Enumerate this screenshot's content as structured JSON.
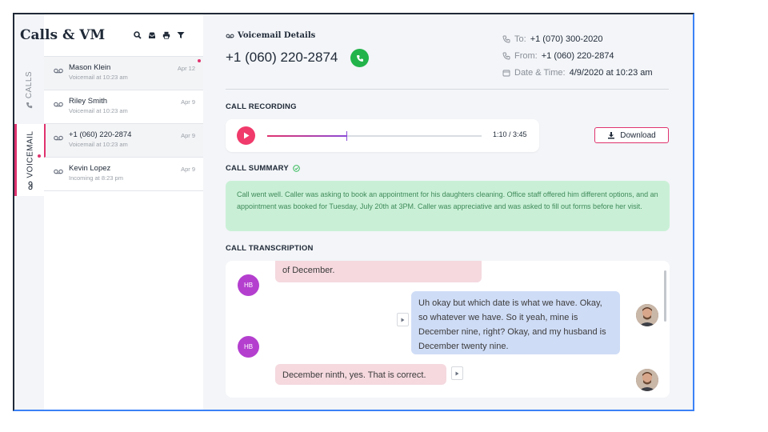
{
  "app": {
    "title": "Calls & VM"
  },
  "tabs": {
    "calls": "CALLS",
    "voicemail": "VOICEMAIL"
  },
  "list": [
    {
      "name": "Mason Klein",
      "sub": "Voicemail at 10:23 am",
      "date": "Apr 12",
      "unread": true
    },
    {
      "name": "Riley Smith",
      "sub": "Voicemail at 10:23 am",
      "date": "Apr 9",
      "unread": false
    },
    {
      "name": "+1 (060) 220-2874",
      "sub": "Voicemail at 10:23 am",
      "date": "Apr 9",
      "unread": false
    },
    {
      "name": "Kevin Lopez",
      "sub": "Incoming at 8:23 pm",
      "date": "Apr 9",
      "unread": false
    }
  ],
  "detail": {
    "section_title": "Voicemail Details",
    "phone": "+1 (060) 220-2874",
    "to_label": "To:",
    "to_value": "+1 (070) 300-2020",
    "from_label": "From:",
    "from_value": "+1 (060) 220-2874",
    "datetime_label": "Date & Time:",
    "datetime_value": "4/9/2020 at 10:23 am"
  },
  "recording": {
    "heading": "CALL RECORDING",
    "time": "1:10 / 3:45",
    "progress": 0.37,
    "download_label": "Download"
  },
  "summary": {
    "heading": "CALL SUMMARY",
    "text": "Call went well. Caller was asking to book an appointment for his daughters cleaning. Office staff offered him different options, and an appointment was booked for Tuesday, July 20th at 3PM. Caller was appreciative and was asked to fill out forms before her visit."
  },
  "transcription": {
    "heading": "CALL TRANSCRIPTION",
    "caller_initials": "HB",
    "messages": [
      {
        "side": "in",
        "text": "of December."
      },
      {
        "side": "out",
        "text": "Uh okay but which date is what we have. Okay, so whatever we have. So it yeah, mine is December nine, right? Okay, and my husband is December twenty nine."
      },
      {
        "side": "in",
        "text": "December ninth, yes. That is correct."
      }
    ]
  },
  "colors": {
    "accent": "#e0336e",
    "call_green": "#22b44a",
    "summary_bg": "#c9f0d6",
    "caller_avatar": "#b43fcf"
  }
}
